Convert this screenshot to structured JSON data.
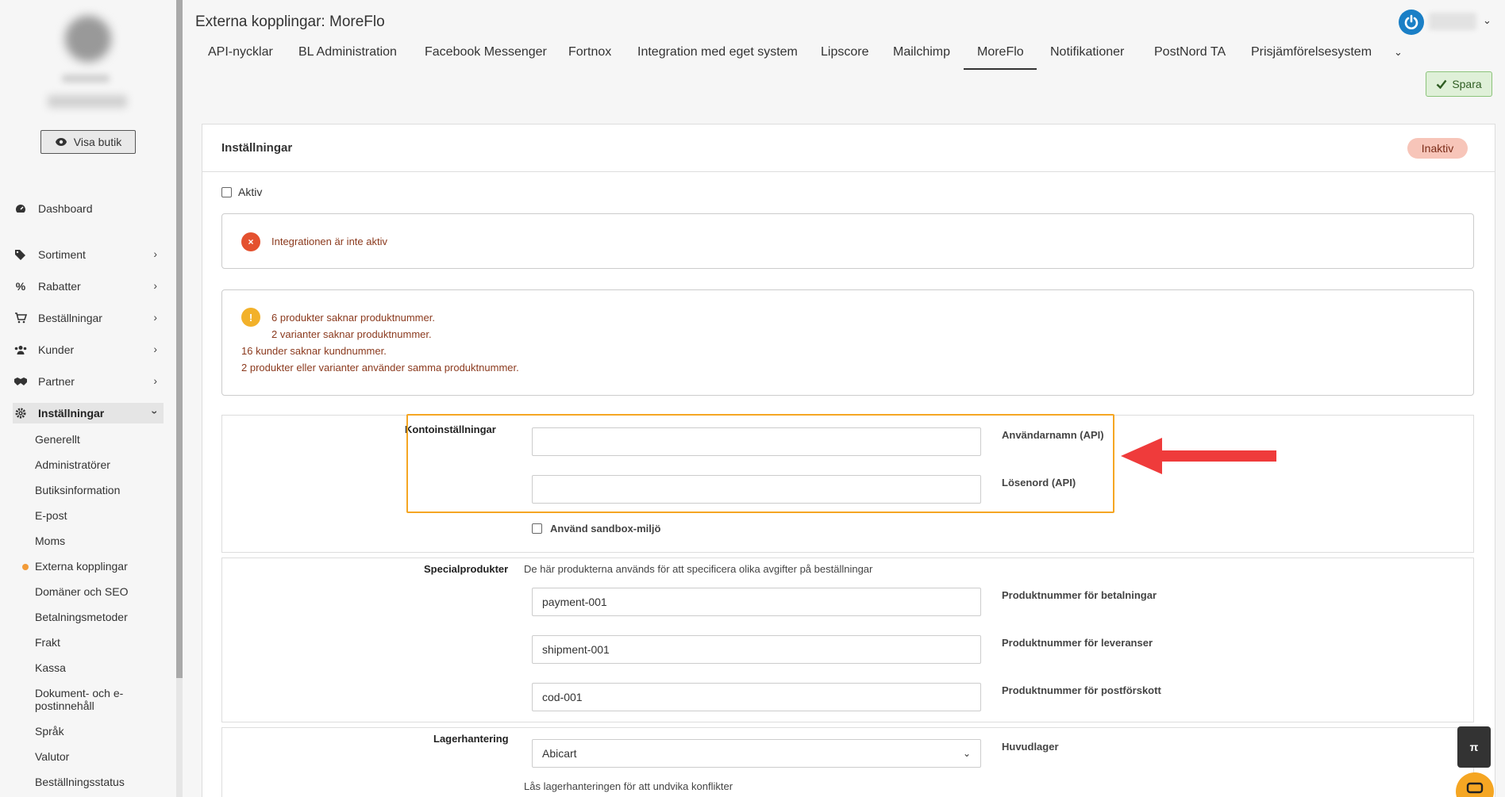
{
  "page_title": "Externa kopplingar: MoreFlo",
  "sidebar": {
    "visa_butik": "Visa butik",
    "items": [
      {
        "label": "Dashboard"
      },
      {
        "label": "Sortiment"
      },
      {
        "label": "Rabatter"
      },
      {
        "label": "Beställningar"
      },
      {
        "label": "Kunder"
      },
      {
        "label": "Partner"
      },
      {
        "label": "Inställningar"
      }
    ],
    "sub_items": [
      {
        "label": "Generellt"
      },
      {
        "label": "Administratörer"
      },
      {
        "label": "Butiksinformation"
      },
      {
        "label": "E-post"
      },
      {
        "label": "Moms"
      },
      {
        "label": "Externa kopplingar"
      },
      {
        "label": "Domäner och SEO"
      },
      {
        "label": "Betalningsmetoder"
      },
      {
        "label": "Frakt"
      },
      {
        "label": "Kassa"
      },
      {
        "label": "Dokument- och e-postinnehåll"
      },
      {
        "label": "Språk"
      },
      {
        "label": "Valutor"
      },
      {
        "label": "Beställningsstatus"
      }
    ]
  },
  "tabs": [
    {
      "label": "API-nycklar"
    },
    {
      "label": "BL Administration"
    },
    {
      "label": "Facebook Messenger"
    },
    {
      "label": "Fortnox"
    },
    {
      "label": "Integration med eget system"
    },
    {
      "label": "Lipscore"
    },
    {
      "label": "Mailchimp"
    },
    {
      "label": "MoreFlo"
    },
    {
      "label": "Notifikationer"
    },
    {
      "label": "PostNord TA"
    },
    {
      "label": "Prisjämförelsesystem"
    }
  ],
  "active_tab": "MoreFlo",
  "spara_label": "Spara",
  "panel": {
    "title": "Inställningar",
    "status_badge": "Inaktiv",
    "aktiv_label": "Aktiv",
    "error_msg": "Integrationen är inte aktiv",
    "warnings": [
      "6 produkter saknar produktnummer.",
      "2 varianter saknar produktnummer.",
      "16 kunder saknar kundnummer.",
      "2 produkter eller varianter använder samma produktnummer."
    ]
  },
  "account": {
    "section_label": "Kontoinställningar",
    "username_label": "Användarnamn (API)",
    "username_value": "",
    "password_label": "Lösenord (API)",
    "password_value": "",
    "sandbox_label": "Använd sandbox-miljö"
  },
  "special": {
    "section_label": "Specialprodukter",
    "description": "De här produkterna används för att specificera olika avgifter på beställningar",
    "fields": [
      {
        "value": "payment-001",
        "label": "Produktnummer för betalningar"
      },
      {
        "value": "shipment-001",
        "label": "Produktnummer för leveranser"
      },
      {
        "value": "cod-001",
        "label": "Produktnummer för postförskott"
      }
    ]
  },
  "stock": {
    "section_label": "Lagerhantering",
    "selected": "Abicart",
    "select_label": "Huvudlager",
    "note": "Lås lagerhanteringen för att undvika konflikter"
  },
  "floating": {
    "pi_label": "π"
  },
  "colors": {
    "accent_orange": "#f5a623",
    "error_red": "#e4512f",
    "warning_yellow": "#f2b12a",
    "arrow_red": "#ef3b3b"
  }
}
